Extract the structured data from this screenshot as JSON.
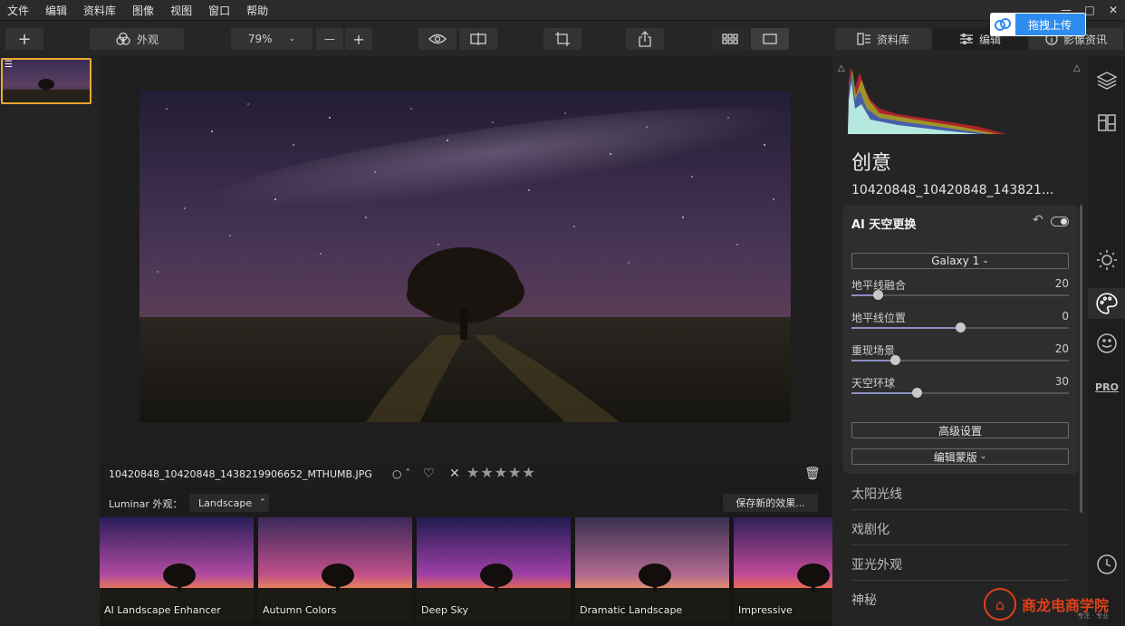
{
  "menu": [
    "文件",
    "编辑",
    "资料库",
    "图像",
    "视图",
    "窗口",
    "帮助"
  ],
  "window_controls": [
    "—",
    "□",
    "✕"
  ],
  "toolbar": {
    "add": "+",
    "looks_label": "外观",
    "zoom": "79%",
    "zoom_out": "—",
    "zoom_in": "+",
    "library_label": "资料库",
    "edit_label": "编辑",
    "info_label": "影像资讯"
  },
  "upload": {
    "label": "拖拽上传"
  },
  "image": {
    "filename": "10420848_10420848_1438219906652_MTHUMB.JPG",
    "rating": 0,
    "max_rating": 5
  },
  "looks": {
    "label": "Luminar 外观：",
    "category": "Landscape",
    "save_label": "保存新的效果...",
    "presets": [
      "AI Landscape Enhancer",
      "Autumn Colors",
      "Deep Sky",
      "Dramatic Landscape",
      "Impressive"
    ]
  },
  "panel": {
    "section_title": "创意",
    "file_label": "10420848_10420848_143821...",
    "tool": {
      "title": "AI 天空更换",
      "sky_select": "Galaxy 1",
      "sliders": [
        {
          "name": "地平线融合",
          "value": 20,
          "fraction": 0.12
        },
        {
          "name": "地平线位置",
          "value": 0,
          "fraction": 0.5
        },
        {
          "name": "重现场景",
          "value": 20,
          "fraction": 0.2
        },
        {
          "name": "天空环球",
          "value": 30,
          "fraction": 0.3
        }
      ],
      "advanced_label": "高级设置",
      "mask_label": "编辑蒙版"
    },
    "categories": [
      "太阳光线",
      "戏剧化",
      "亚光外观",
      "神秘"
    ]
  },
  "side_icons": [
    "layers-icon",
    "tools-icon",
    "sun-icon",
    "palette-icon",
    "smile-icon",
    "pro-icon",
    "history-icon"
  ],
  "watermark": {
    "text": "商龙电商学院",
    "sub": "专注 · 专业"
  },
  "colors": {
    "accent": "#2d8cf0",
    "selection": "#f0a830",
    "slider_fill": "#8a8fc4"
  }
}
